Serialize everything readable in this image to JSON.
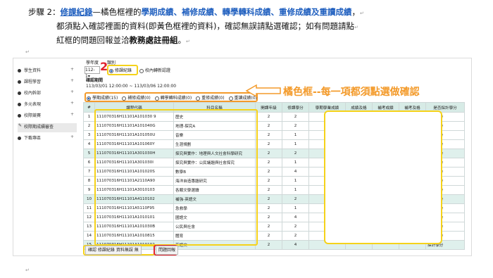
{
  "instructions": {
    "step_label": "步驟 2：",
    "course_record": "修課紀錄",
    "dash_orange": "—",
    "line1_mid": "橘色框裡的",
    "line1_blue": "學期成績、補修成績、轉學轉科成績、重修成績及重讀成績",
    "line1_end": "，",
    "line2": "都須點入確認裡面的資料(即黃色框裡的資料)，確認無誤請點選確認；如有問題請點",
    "line3_start": "紅框的問題回報並洽",
    "line3_bold": "教務處註冊組",
    "line3_end": "。"
  },
  "callout": {
    "number": "2",
    "text": "橘色框--每一項都須點選做確認"
  },
  "sidebar": [
    {
      "label": "學生資料",
      "plus": "+"
    },
    {
      "label": "課程學習",
      "plus": "+"
    },
    {
      "label": "校內幹部",
      "plus": "+"
    },
    {
      "label": "多元表現",
      "plus": "+"
    },
    {
      "label": "校際競賽",
      "plus": "+"
    },
    {
      "label": "校際期成續審查",
      "plus": ""
    },
    {
      "label": "下載專區",
      "plus": "+"
    }
  ],
  "top": {
    "year_label": "學年度",
    "type_label": "類別",
    "year_value": "112-1",
    "radio_course": "修課紀錄",
    "radio_transfer": "校內轉新認證",
    "period_label": "確認期間",
    "period_value": "113/03/01 12:00:00 ~ 113/03/06 12:00:00"
  },
  "tabs": [
    "學期成績(15)",
    "補修成績(0)",
    "轉學轉科成績(0)",
    "重修成績(0)",
    "重讀成績(0)"
  ],
  "table": {
    "headers": [
      "#",
      "課程代碼",
      "科目名稱",
      "開課年級",
      "修課學分",
      "學期學業成績",
      "成績及格",
      "補考成績",
      "補考及格",
      "是否採計學分"
    ],
    "rows": [
      [
        "1",
        "111070316H11101A101030 9",
        "歷史",
        "2",
        "2",
        "",
        "",
        "",
        "",
        "採計學分"
      ],
      [
        "2",
        "111070316H11101A101040G",
        "地理-探究A",
        "2",
        "2",
        "",
        "",
        "",
        "",
        "採計學分"
      ],
      [
        "3",
        "111070316H11101A101050U",
        "音樂",
        "2",
        "1",
        "",
        "",
        "",
        "",
        "採計學分"
      ],
      [
        "4",
        "111070316H11101A101060Y",
        "生涯規劃",
        "2",
        "1",
        "",
        "",
        "",
        "",
        "採計學分"
      ],
      [
        "5",
        "111070316H11101A301030H",
        "探究與實作：地理與人文社會科學研究",
        "2",
        "2",
        "",
        "",
        "",
        "",
        "採計學分"
      ],
      [
        "6",
        "111070316H11101A301030I",
        "探究與實作：公民議題與社會探究",
        "2",
        "1",
        "",
        "",
        "",
        "",
        "採計學分"
      ],
      [
        "7",
        "111070316H11101A101020S",
        "數學B",
        "2",
        "4",
        "",
        "",
        "",
        "",
        "採計學分"
      ],
      [
        "8",
        "111070316H11101A2110A90",
        "海洋自造專題研究",
        "2",
        "1",
        "",
        "",
        "",
        "",
        "採計學分"
      ],
      [
        "9",
        "111070316H11101A3010103",
        "各類文學選讀",
        "2",
        "1",
        "",
        "",
        "",
        "",
        "採計學分"
      ],
      [
        "10",
        "111070316H11101A4110102",
        "補強-英語文",
        "2",
        "2",
        "",
        "",
        "",
        "",
        "採計學分"
      ],
      [
        "11",
        "111070316H11101A5110F95",
        "急救學",
        "2",
        "1",
        "",
        "",
        "",
        "",
        "採計學分"
      ],
      [
        "12",
        "111070316H11101A1010101",
        "國語文",
        "2",
        "4",
        "",
        "",
        "",
        "",
        "採計學分"
      ],
      [
        "13",
        "111070316H11101A101030B",
        "公民與社會",
        "2",
        "2",
        "",
        "",
        "",
        "",
        "採計學分"
      ],
      [
        "14",
        "111070316H11101A1010815",
        "體育",
        "2",
        "2",
        "",
        "",
        "",
        "",
        "採計學分"
      ],
      [
        "15",
        "111070316H11101A1010102",
        "英語文",
        "2",
        "4",
        "",
        "",
        "",
        "",
        "採計學分"
      ]
    ]
  },
  "buttons": {
    "confirm": "確認 修課紀錄 資料無誤 無",
    "report": "問題回報"
  },
  "colors": {
    "blue": "#1f5fbf",
    "orange": "#f39a2a",
    "yellow": "#f5d21a",
    "red": "#e0232d",
    "teal_header": "#d7ebe6"
  }
}
